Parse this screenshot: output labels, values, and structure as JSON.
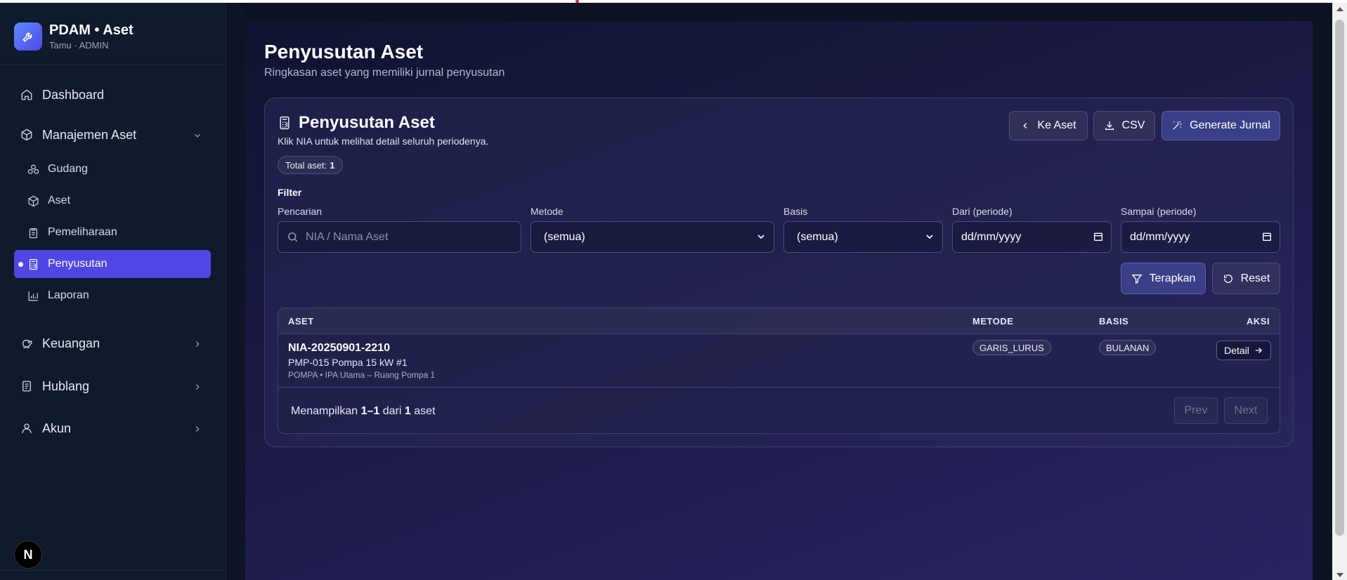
{
  "brand": {
    "title": "PDAM • Aset",
    "subtitle": "Tamu · ADMIN",
    "logo_icon": "wrench-icon",
    "accent": "#4f46e5"
  },
  "sidebar": {
    "dashboard": "Dashboard",
    "manajemen": "Manajemen Aset",
    "sub": {
      "gudang": "Gudang",
      "aset": "Aset",
      "pemeliharaan": "Pemeliharaan",
      "penyusutan": "Penyusutan",
      "laporan": "Laporan"
    },
    "keuangan": "Keuangan",
    "hublang": "Hublang",
    "akun": "Akun",
    "next_badge": "N"
  },
  "page": {
    "title": "Penyusutan Aset",
    "subtitle": "Ringkasan aset yang memiliki jurnal penyusutan"
  },
  "card": {
    "title": "Penyusutan Aset",
    "subtitle": "Klik NIA untuk melihat detail seluruh periodenya.",
    "total_label": "Total aset:",
    "total_value": "1",
    "buttons": {
      "ke_aset": "Ke Aset",
      "csv": "CSV",
      "generate": "Generate Jurnal"
    }
  },
  "filter": {
    "heading": "Filter",
    "pencarian_label": "Pencarian",
    "pencarian_placeholder": "NIA / Nama Aset",
    "metode_label": "Metode",
    "metode_value": "(semua)",
    "basis_label": "Basis",
    "basis_value": "(semua)",
    "dari_label": "Dari (periode)",
    "dari_value": "dd/mm/yyyy",
    "sampai_label": "Sampai (periode)",
    "sampai_value": "dd/mm/yyyy",
    "terapkan": "Terapkan",
    "reset": "Reset"
  },
  "table": {
    "headers": {
      "aset": "ASET",
      "metode": "METODE",
      "basis": "BASIS",
      "aksi": "AKSI"
    },
    "rows": [
      {
        "nia": "NIA-20250901-2210",
        "name": "PMP-015 Pompa 15 kW #1",
        "location": "POMPA • IPA Utama – Ruang Pompa 1",
        "metode": "GARIS_LURUS",
        "basis": "BULANAN",
        "aksi": "Detail"
      }
    ],
    "footer": {
      "prefix": "Menampilkan",
      "range": "1–1",
      "mid": "dari",
      "count": "1",
      "suffix": "aset"
    },
    "prev": "Prev",
    "next": "Next"
  }
}
